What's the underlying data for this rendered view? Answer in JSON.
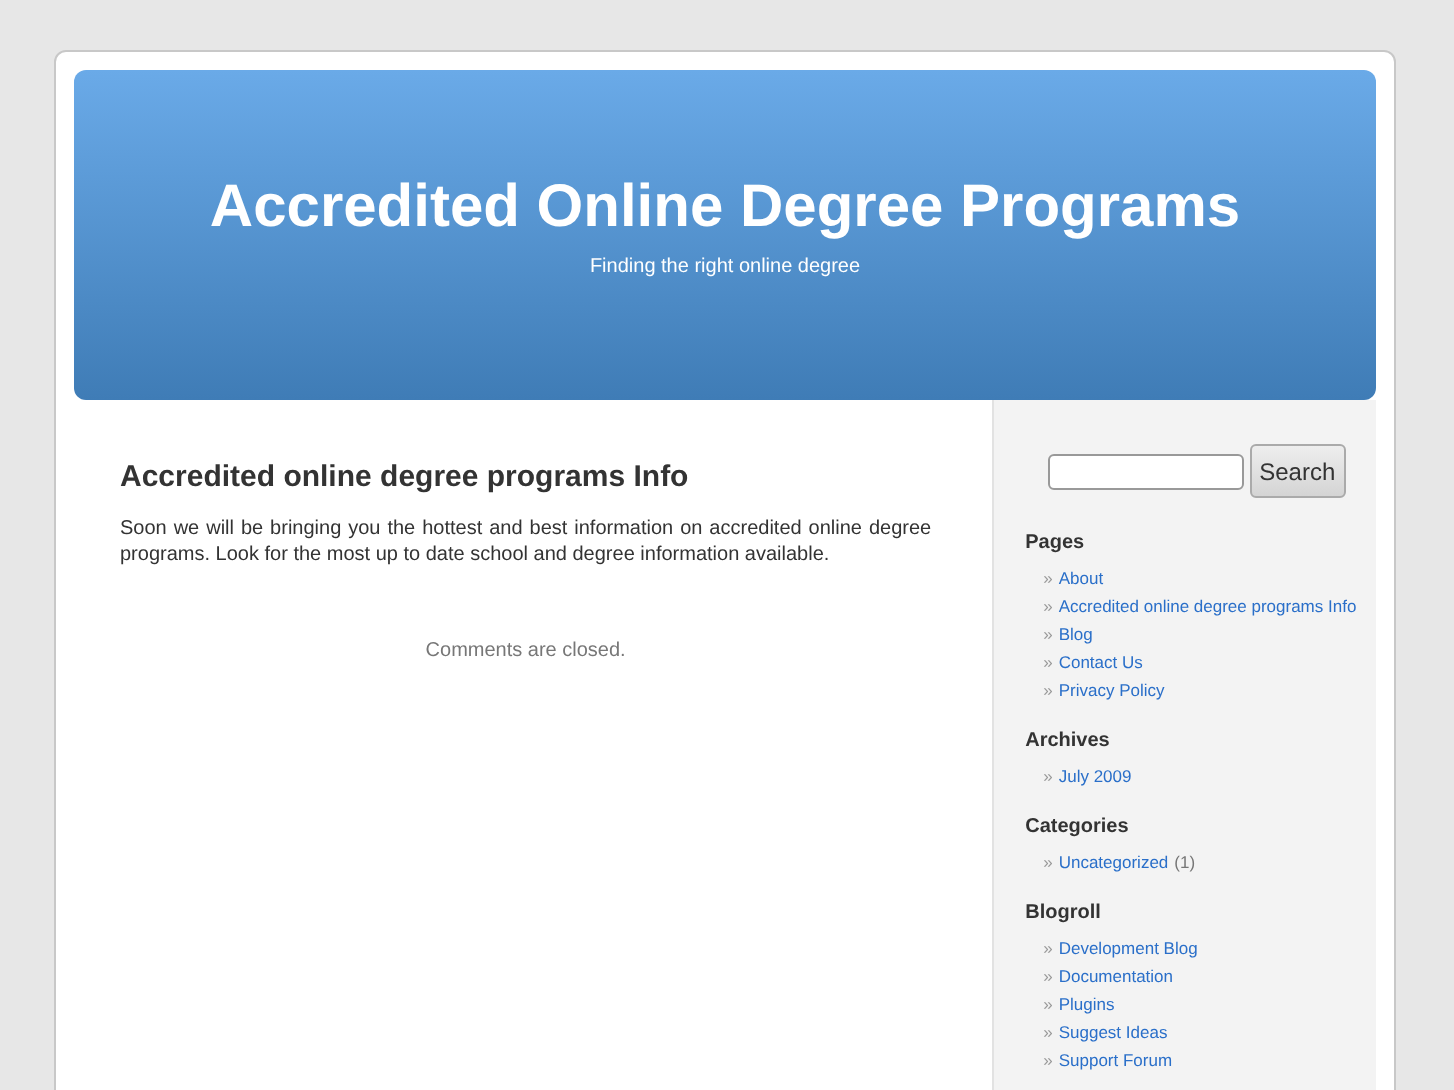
{
  "header": {
    "title": "Accredited Online Degree Programs",
    "tagline": "Finding the right online degree"
  },
  "post": {
    "title": "Accredited online degree programs Info",
    "body": "Soon we will be bringing you the hottest and best information on accredited online degree programs.  Look for the most up to date school and degree information available.",
    "comments_note": "Comments are closed."
  },
  "sidebar": {
    "search": {
      "button": "Search"
    },
    "sections": [
      {
        "heading": "Pages",
        "items": [
          {
            "bullet": "»",
            "label": "About"
          },
          {
            "bullet": "»",
            "label": "Accredited online degree programs Info"
          },
          {
            "bullet": "»",
            "label": "Blog"
          },
          {
            "bullet": "»",
            "label": "Contact Us"
          },
          {
            "bullet": "»",
            "label": "Privacy Policy"
          }
        ]
      },
      {
        "heading": "Archives",
        "items": [
          {
            "bullet": "»",
            "label": "July 2009"
          }
        ]
      },
      {
        "heading": "Categories",
        "items": [
          {
            "bullet": "»",
            "label": "Uncategorized",
            "count": "(1)"
          }
        ]
      },
      {
        "heading": "Blogroll",
        "items": [
          {
            "bullet": "»",
            "label": "Development Blog"
          },
          {
            "bullet": "»",
            "label": "Documentation"
          },
          {
            "bullet": "»",
            "label": "Plugins"
          },
          {
            "bullet": "»",
            "label": "Suggest Ideas"
          },
          {
            "bullet": "»",
            "label": "Support Forum"
          }
        ]
      }
    ]
  }
}
